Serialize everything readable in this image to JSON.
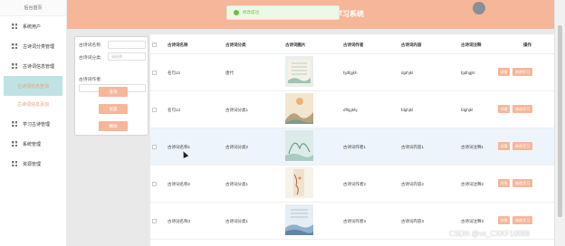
{
  "sidebar": {
    "home": "后台首页",
    "items": [
      {
        "label": "系统用户",
        "icon": "grid-icon"
      },
      {
        "label": "古诗词分类管理",
        "icon": "grid-icon"
      },
      {
        "label": "古诗词信息管理",
        "icon": "grid-icon"
      },
      {
        "label": "古诗词信息查询",
        "icon": "none"
      },
      {
        "label": "古诗词信息添加",
        "icon": "none"
      },
      {
        "label": "学习古诗管理",
        "icon": "grid-icon"
      },
      {
        "label": "系统管理",
        "icon": "grid-icon"
      },
      {
        "label": "资源管理",
        "icon": "grid-icon"
      }
    ]
  },
  "header": {
    "title": "学习系统",
    "toast": "修改成功"
  },
  "search": {
    "name_label": "古诗词名称:",
    "category_label": "古诗词分类:",
    "category_placeholder": "请选择",
    "author_label": "古诗词作者:",
    "query_button": "查询",
    "reset_button": "重置",
    "delete_button": "删除"
  },
  "table": {
    "columns": [
      "古诗词名称",
      "古诗词分类",
      "古诗词图片",
      "古诗词作者",
      "古诗词内容",
      "古诗词注释",
      "操作"
    ],
    "rows": [
      {
        "name": "名句12",
        "category": "唐代",
        "author": "hjdfgjkh",
        "content": "dgthjkl",
        "note": "fgdhgjkl"
      },
      {
        "name": "名句13",
        "category": "古诗词分类1",
        "author": "dfhjgkhj",
        "content": "fdghjkl",
        "note": "fdghjkl"
      },
      {
        "name": "古诗词名称1",
        "category": "古诗词分类2",
        "author": "古诗词作者1",
        "content": "古诗词内容1",
        "note": "古诗词注释1"
      },
      {
        "name": "古诗词名称2",
        "category": "古诗词分类1",
        "author": "古诗词作者2",
        "content": "古诗词内容2",
        "note": "古诗词注释2"
      },
      {
        "name": "古诗词名称3",
        "category": "古诗词分类1",
        "author": "古诗词作者3",
        "content": "古诗词内容3",
        "note": "古诗词注释3"
      }
    ],
    "edit_label": "详情",
    "learn_label": "修改学习"
  },
  "watermark": "CSDN @vx_CXKF10088",
  "colors": {
    "accent": "#f6b69a",
    "sidebar_active": "#bfe3e4",
    "toast_green": "#67c23a"
  }
}
